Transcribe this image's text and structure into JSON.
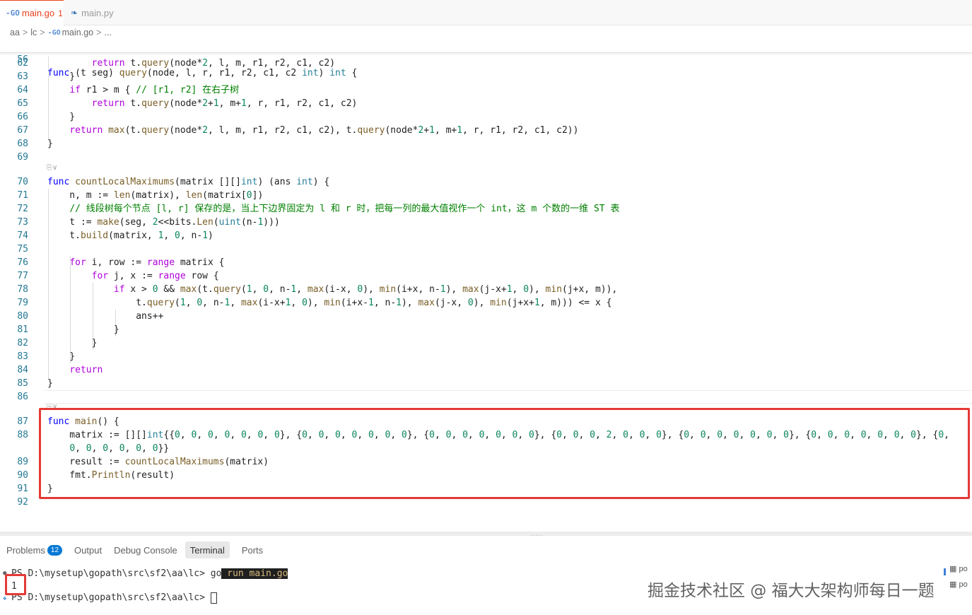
{
  "tabs": [
    {
      "label": "main.go",
      "dirty": "1",
      "icon": "go-file-icon",
      "active": true
    },
    {
      "label": "main.py",
      "icon": "python-file-icon",
      "active": false
    }
  ],
  "breadcrumb": [
    "aa",
    "lc",
    "main.go",
    "..."
  ],
  "editor": {
    "sticky_line": {
      "num": "56",
      "text": "func (t seg) query(node, l, r, r1, r2, c1, c2 int) int {"
    },
    "lines": [
      {
        "num": "62",
        "text": "        return t.query(node*2, l, m, r1, r2, c1, c2)"
      },
      {
        "num": "63",
        "text": "    }"
      },
      {
        "num": "64",
        "text": "    if r1 > m { // [r1, r2] 在右子树"
      },
      {
        "num": "65",
        "text": "        return t.query(node*2+1, m+1, r, r1, r2, c1, c2)"
      },
      {
        "num": "66",
        "text": "    }"
      },
      {
        "num": "67",
        "text": "    return max(t.query(node*2, l, m, r1, r2, c1, c2), t.query(node*2+1, m+1, r, r1, r2, c1, c2))"
      },
      {
        "num": "68",
        "text": "}"
      },
      {
        "num": "69",
        "text": ""
      },
      {
        "num": "70",
        "text": "func countLocalMaximums(matrix [][]int) (ans int) {"
      },
      {
        "num": "71",
        "text": "    n, m := len(matrix), len(matrix[0])"
      },
      {
        "num": "72",
        "text": "    // 线段树每个节点 [l, r] 保存的是，当上下边界固定为 l 和 r 时，把每一列的最大值视作一个 int，这 m 个数的一维 ST 表"
      },
      {
        "num": "73",
        "text": "    t := make(seg, 2<<bits.Len(uint(n-1)))"
      },
      {
        "num": "74",
        "text": "    t.build(matrix, 1, 0, n-1)"
      },
      {
        "num": "75",
        "text": ""
      },
      {
        "num": "76",
        "text": "    for i, row := range matrix {"
      },
      {
        "num": "77",
        "text": "        for j, x := range row {"
      },
      {
        "num": "78",
        "text": "            if x > 0 && max(t.query(1, 0, n-1, max(i-x, 0), min(i+x, n-1), max(j-x+1, 0), min(j+x, m)),"
      },
      {
        "num": "79",
        "text": "                t.query(1, 0, n-1, max(i-x+1, 0), min(i+x-1, n-1), max(j-x, 0), min(j+x+1, m))) <= x {"
      },
      {
        "num": "80",
        "text": "                ans++"
      },
      {
        "num": "81",
        "text": "            }"
      },
      {
        "num": "82",
        "text": "        }"
      },
      {
        "num": "83",
        "text": "    }"
      },
      {
        "num": "84",
        "text": "    return"
      },
      {
        "num": "85",
        "text": "}"
      },
      {
        "num": "86",
        "text": ""
      },
      {
        "num": "87",
        "text": "func main() {"
      },
      {
        "num": "88",
        "text": "    matrix := [][]int{{0, 0, 0, 0, 0, 0, 0}, {0, 0, 0, 0, 0, 0, 0}, {0, 0, 0, 0, 0, 0, 0}, {0, 0, 0, 2, 0, 0, 0}, {0, 0, 0, 0, 0, 0, 0}, {0, 0, 0, 0, 0, 0, 0}, {0,"
      },
      {
        "num": "",
        "text": "    0, 0, 0, 0, 0, 0}}"
      },
      {
        "num": "89",
        "text": "    result := countLocalMaximums(matrix)"
      },
      {
        "num": "90",
        "text": "    fmt.Println(result)"
      },
      {
        "num": "91",
        "text": "}"
      },
      {
        "num": "92",
        "text": ""
      }
    ]
  },
  "panel": {
    "tabs": [
      "Problems",
      "Output",
      "Debug Console",
      "Terminal",
      "Ports"
    ],
    "problems_count": "12",
    "active_tab": "Terminal"
  },
  "terminal": {
    "prompt1": "PS D:\\mysetup\\gopath\\src\\sf2\\aa\\lc> ",
    "cmd_go": "go",
    "cmd_rest": " run main.go",
    "output": "1",
    "prompt2": "PS D:\\mysetup\\gopath\\src\\sf2\\aa\\lc> "
  },
  "terminal_list": [
    "po",
    "po"
  ],
  "watermark": "掘金技术社区 @ 福大大架构师每日一题",
  "colors": {
    "accent": "#e8411b",
    "highlight": "#e53935",
    "badge": "#0078d4",
    "line_number": "#237893"
  }
}
